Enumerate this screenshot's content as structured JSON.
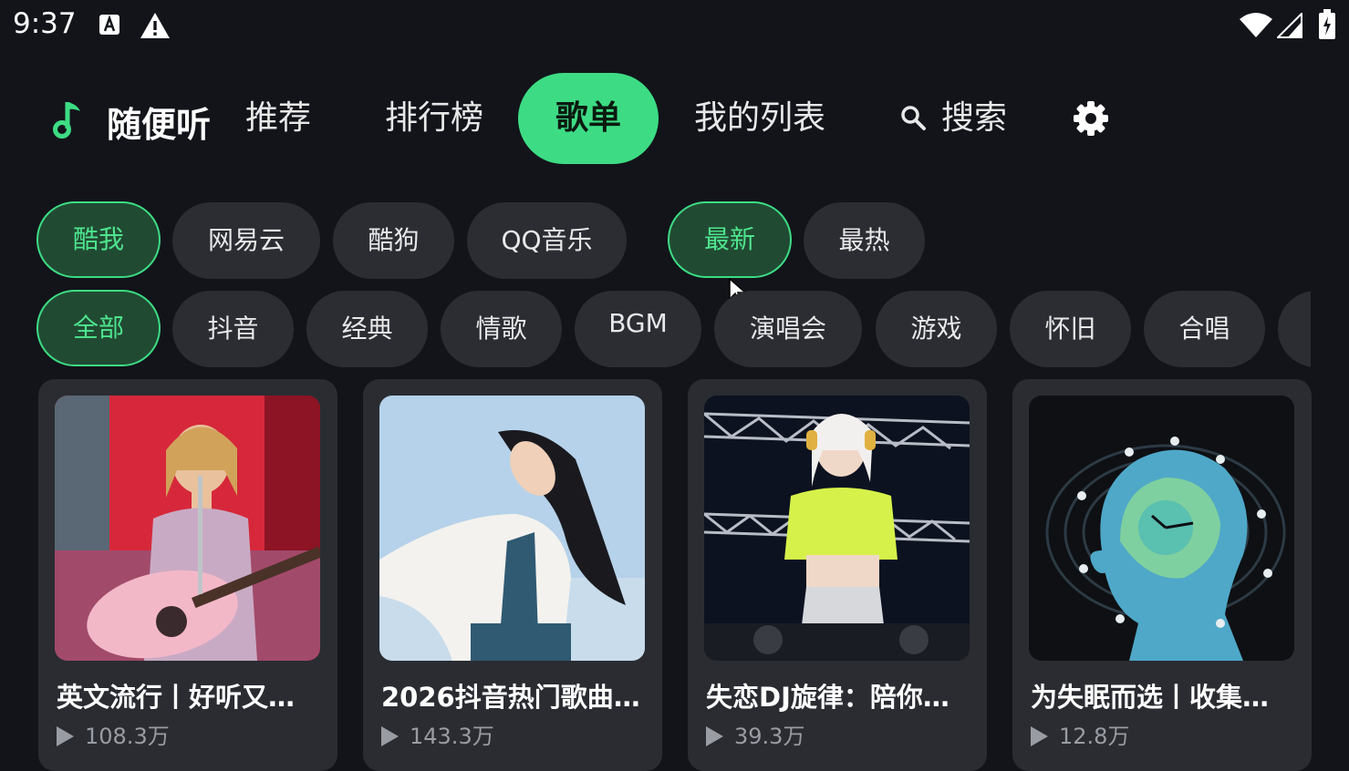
{
  "status_bar": {
    "time": "9:37",
    "icons": [
      "a11y-icon",
      "warning-icon",
      "wifi-icon",
      "signal-icon",
      "battery-icon"
    ]
  },
  "nav": {
    "app_title": "随便听",
    "logo_icon": "music-note-icon",
    "tabs": [
      {
        "label": "推荐",
        "active": false
      },
      {
        "label": "排行榜",
        "active": false
      },
      {
        "label": "歌单",
        "active": true
      },
      {
        "label": "我的列表",
        "active": false
      }
    ],
    "search_label": "搜索",
    "settings_icon": "gear-icon"
  },
  "sources": [
    {
      "label": "酷我",
      "active": true
    },
    {
      "label": "网易云",
      "active": false
    },
    {
      "label": "酷狗",
      "active": false
    },
    {
      "label": "QQ音乐",
      "active": false
    }
  ],
  "sort": [
    {
      "label": "最新",
      "active": true
    },
    {
      "label": "最热",
      "active": false
    }
  ],
  "categories": [
    {
      "label": "全部",
      "active": true
    },
    {
      "label": "抖音",
      "active": false
    },
    {
      "label": "经典",
      "active": false
    },
    {
      "label": "情歌",
      "active": false
    },
    {
      "label": "BGM",
      "active": false
    },
    {
      "label": "演唱会",
      "active": false
    },
    {
      "label": "游戏",
      "active": false
    },
    {
      "label": "怀旧",
      "active": false
    },
    {
      "label": "合唱",
      "active": false
    }
  ],
  "playlists": [
    {
      "title": "英文流行丨好听又…",
      "plays": "108.3万"
    },
    {
      "title": "2026抖音热门歌曲…",
      "plays": "143.3万"
    },
    {
      "title": "失恋DJ旋律：陪你…",
      "plays": "39.3万"
    },
    {
      "title": "为失眠而选丨收集…",
      "plays": "12.8万"
    }
  ],
  "colors": {
    "background": "#12141a",
    "accent": "#3ddc84",
    "chip": "#2b2d33",
    "card": "#2a2c32"
  }
}
